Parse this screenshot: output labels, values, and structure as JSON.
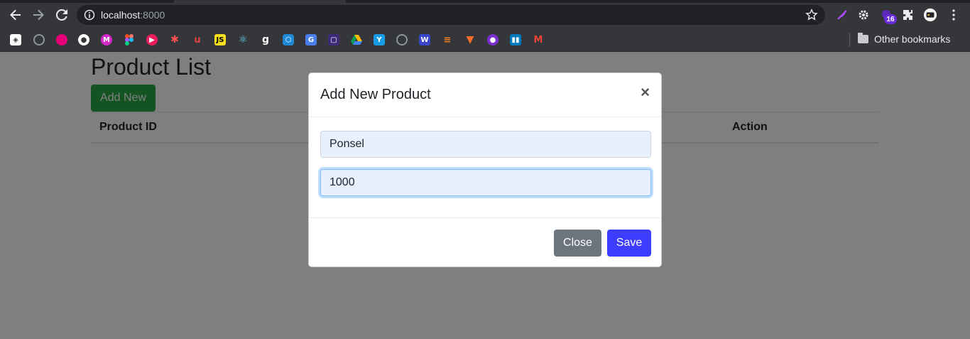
{
  "browser": {
    "url_host": "localhost",
    "url_port": ":8000",
    "extension_badge": "16",
    "other_bookmarks": "Other bookmarks"
  },
  "page": {
    "title": "Product List",
    "add_new_label": "Add New",
    "columns": [
      "Product ID",
      "Action"
    ]
  },
  "modal": {
    "title": "Add New Product",
    "close_symbol": "×",
    "fields": {
      "name_value": "Ponsel",
      "price_value": "1000"
    },
    "close_label": "Close",
    "save_label": "Save"
  },
  "colors": {
    "accent_green": "#28a745",
    "save_blue": "#3d3dff",
    "close_gray": "#6c757d"
  }
}
